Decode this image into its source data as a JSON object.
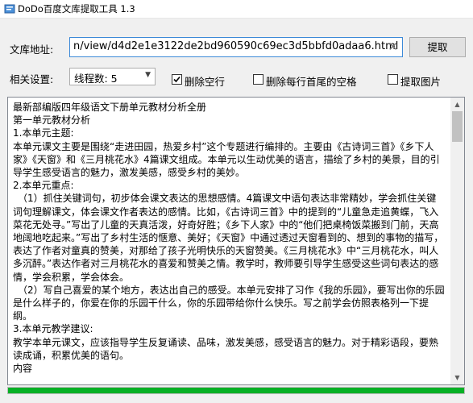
{
  "window": {
    "title": "DoDo百度文库提取工具  1.3"
  },
  "form": {
    "url_label": "文库地址:",
    "url_value": "n/view/d4d2e1e3122de2bd960590c69ec3d5bbfd0adaa6.html",
    "extract_button": "提取",
    "settings_label": "相关设置:",
    "threads_value": "线程数: 5",
    "checkboxes": [
      {
        "label": "删除空行",
        "checked": true
      },
      {
        "label": "删除每行首尾的空格",
        "checked": false
      },
      {
        "label": "提取图片",
        "checked": false
      }
    ]
  },
  "content": {
    "lines": [
      "最新部编版四年级语文下册单元教材分析全册",
      "第一单元教材分析",
      "1.本单元主题:",
      "本单元课文主要是围绕“走进田园，热爱乡村”这个专题进行编排的。主要由《古诗词三首》《乡下人家》《天窗》和《三月桃花水》4篇课文组成。本单元以生动优美的语言，描绘了乡村的美景，目的引导学生感受语言的魅力，激发美感，感受乡村的美妙。",
      "2.本单元重点:",
      "（1）抓住关键词句，初步体会课文表达的思想感情。4篇课文中语句表达非常精妙，学会抓住关键词句理解课文，体会课文作者表达的感情。比如，《古诗词三首》中的提到的“儿童急走追黄蝶，飞入菜花无处寻。”写出了儿童的天真活泼，好奇好胜；《乡下人家》中的“他们把桌椅饭菜搬到门前，天高地阔地吃起来。”写出了乡村生活的惬意、美好；《天窗》中通过透过天窗看到的、想到的事物的描写，表达了作者对童真的赞美，对那给了孩子光明快乐的天窗赞美。《三月桃花水》中“三月桃花水，叫人多沉醉。”表达作者对三月桃花水的喜爱和赞美之情。教学时，教师要引导学生感受这些词句表达的感情，学会积累，学会体会。",
      "（2）写自己喜爱的某个地方，表达出自己的感受。本单元安排了习作《我的乐园》，要写出你的乐园是什么样子的，你爱在你的乐园干什么，你的乐园带给你什么快乐。写之前学会仿照表格列一下提纲。",
      "3.本单元教学建议:",
      "教学本单元课文，应该指导学生反复诵读、品味，激发美感，感受语言的魅力。对于精彩语段，要熟读成诵，积累优美的语句。",
      "内容"
    ]
  },
  "status": {
    "progress": 1.0
  }
}
